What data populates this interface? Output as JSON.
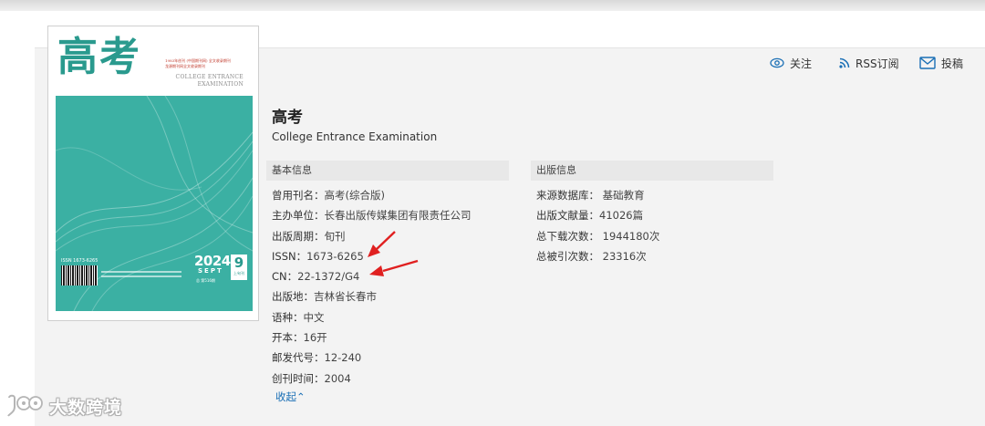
{
  "colors": {
    "accent_teal": "#3bb0a3",
    "link_blue": "#1a6fb5",
    "arrow_red": "#e02020",
    "panel_bg": "#f3f3f3"
  },
  "cover": {
    "title_cn": "高考",
    "masthead_line1": "1983年创刊 (中国期刊网) 全文收录期刊",
    "masthead_line2": "龙源期刊网全文收录期刊",
    "title_en_line1": "COLLEGE ENTRANCE",
    "title_en_line2": "EXAMINATION",
    "issn": "ISSN 1673-6265",
    "year": "2024",
    "month": "SEPT",
    "issue_number": "9",
    "issue_half": "上旬刊",
    "issue_total": "总 第516期"
  },
  "actions": {
    "follow": {
      "label": "关注",
      "icon": "eye-icon"
    },
    "rss": {
      "label": "RSS订阅",
      "icon": "rss-icon"
    },
    "submit": {
      "label": "投稿",
      "icon": "envelope-icon"
    }
  },
  "journal": {
    "title": "高考",
    "subtitle": "College Entrance Examination"
  },
  "basic_info": {
    "header": "基本信息",
    "items": [
      {
        "label": "曾用刊名：",
        "value": "高考(综合版)"
      },
      {
        "label": "主办单位：",
        "value": "长春出版传媒集团有限责任公司"
      },
      {
        "label": "出版周期：",
        "value": "旬刊"
      },
      {
        "label": "ISSN：",
        "value": "1673-6265"
      },
      {
        "label": "CN：",
        "value": "22-1372/G4"
      },
      {
        "label": "出版地：",
        "value": "吉林省长春市"
      },
      {
        "label": "语种：",
        "value": "中文"
      },
      {
        "label": "开本：",
        "value": "16开"
      },
      {
        "label": "邮发代号：",
        "value": "12-240"
      },
      {
        "label": "创刊时间：",
        "value": "2004"
      }
    ],
    "collapse_label": "收起",
    "collapse_icon": "double-chevron-up-icon"
  },
  "publication_info": {
    "header": "出版信息",
    "items": [
      {
        "label": "来源数据库：",
        "value": " 基础教育"
      },
      {
        "label": "出版文献量：",
        "value": "41026篇"
      },
      {
        "label": "总下载次数：",
        "value": " 1944180次"
      },
      {
        "label": "总被引次数：",
        "value": " 23316次"
      }
    ]
  },
  "watermark": {
    "text": "大数跨境",
    "icon": "chat-bubble-logo-icon"
  }
}
